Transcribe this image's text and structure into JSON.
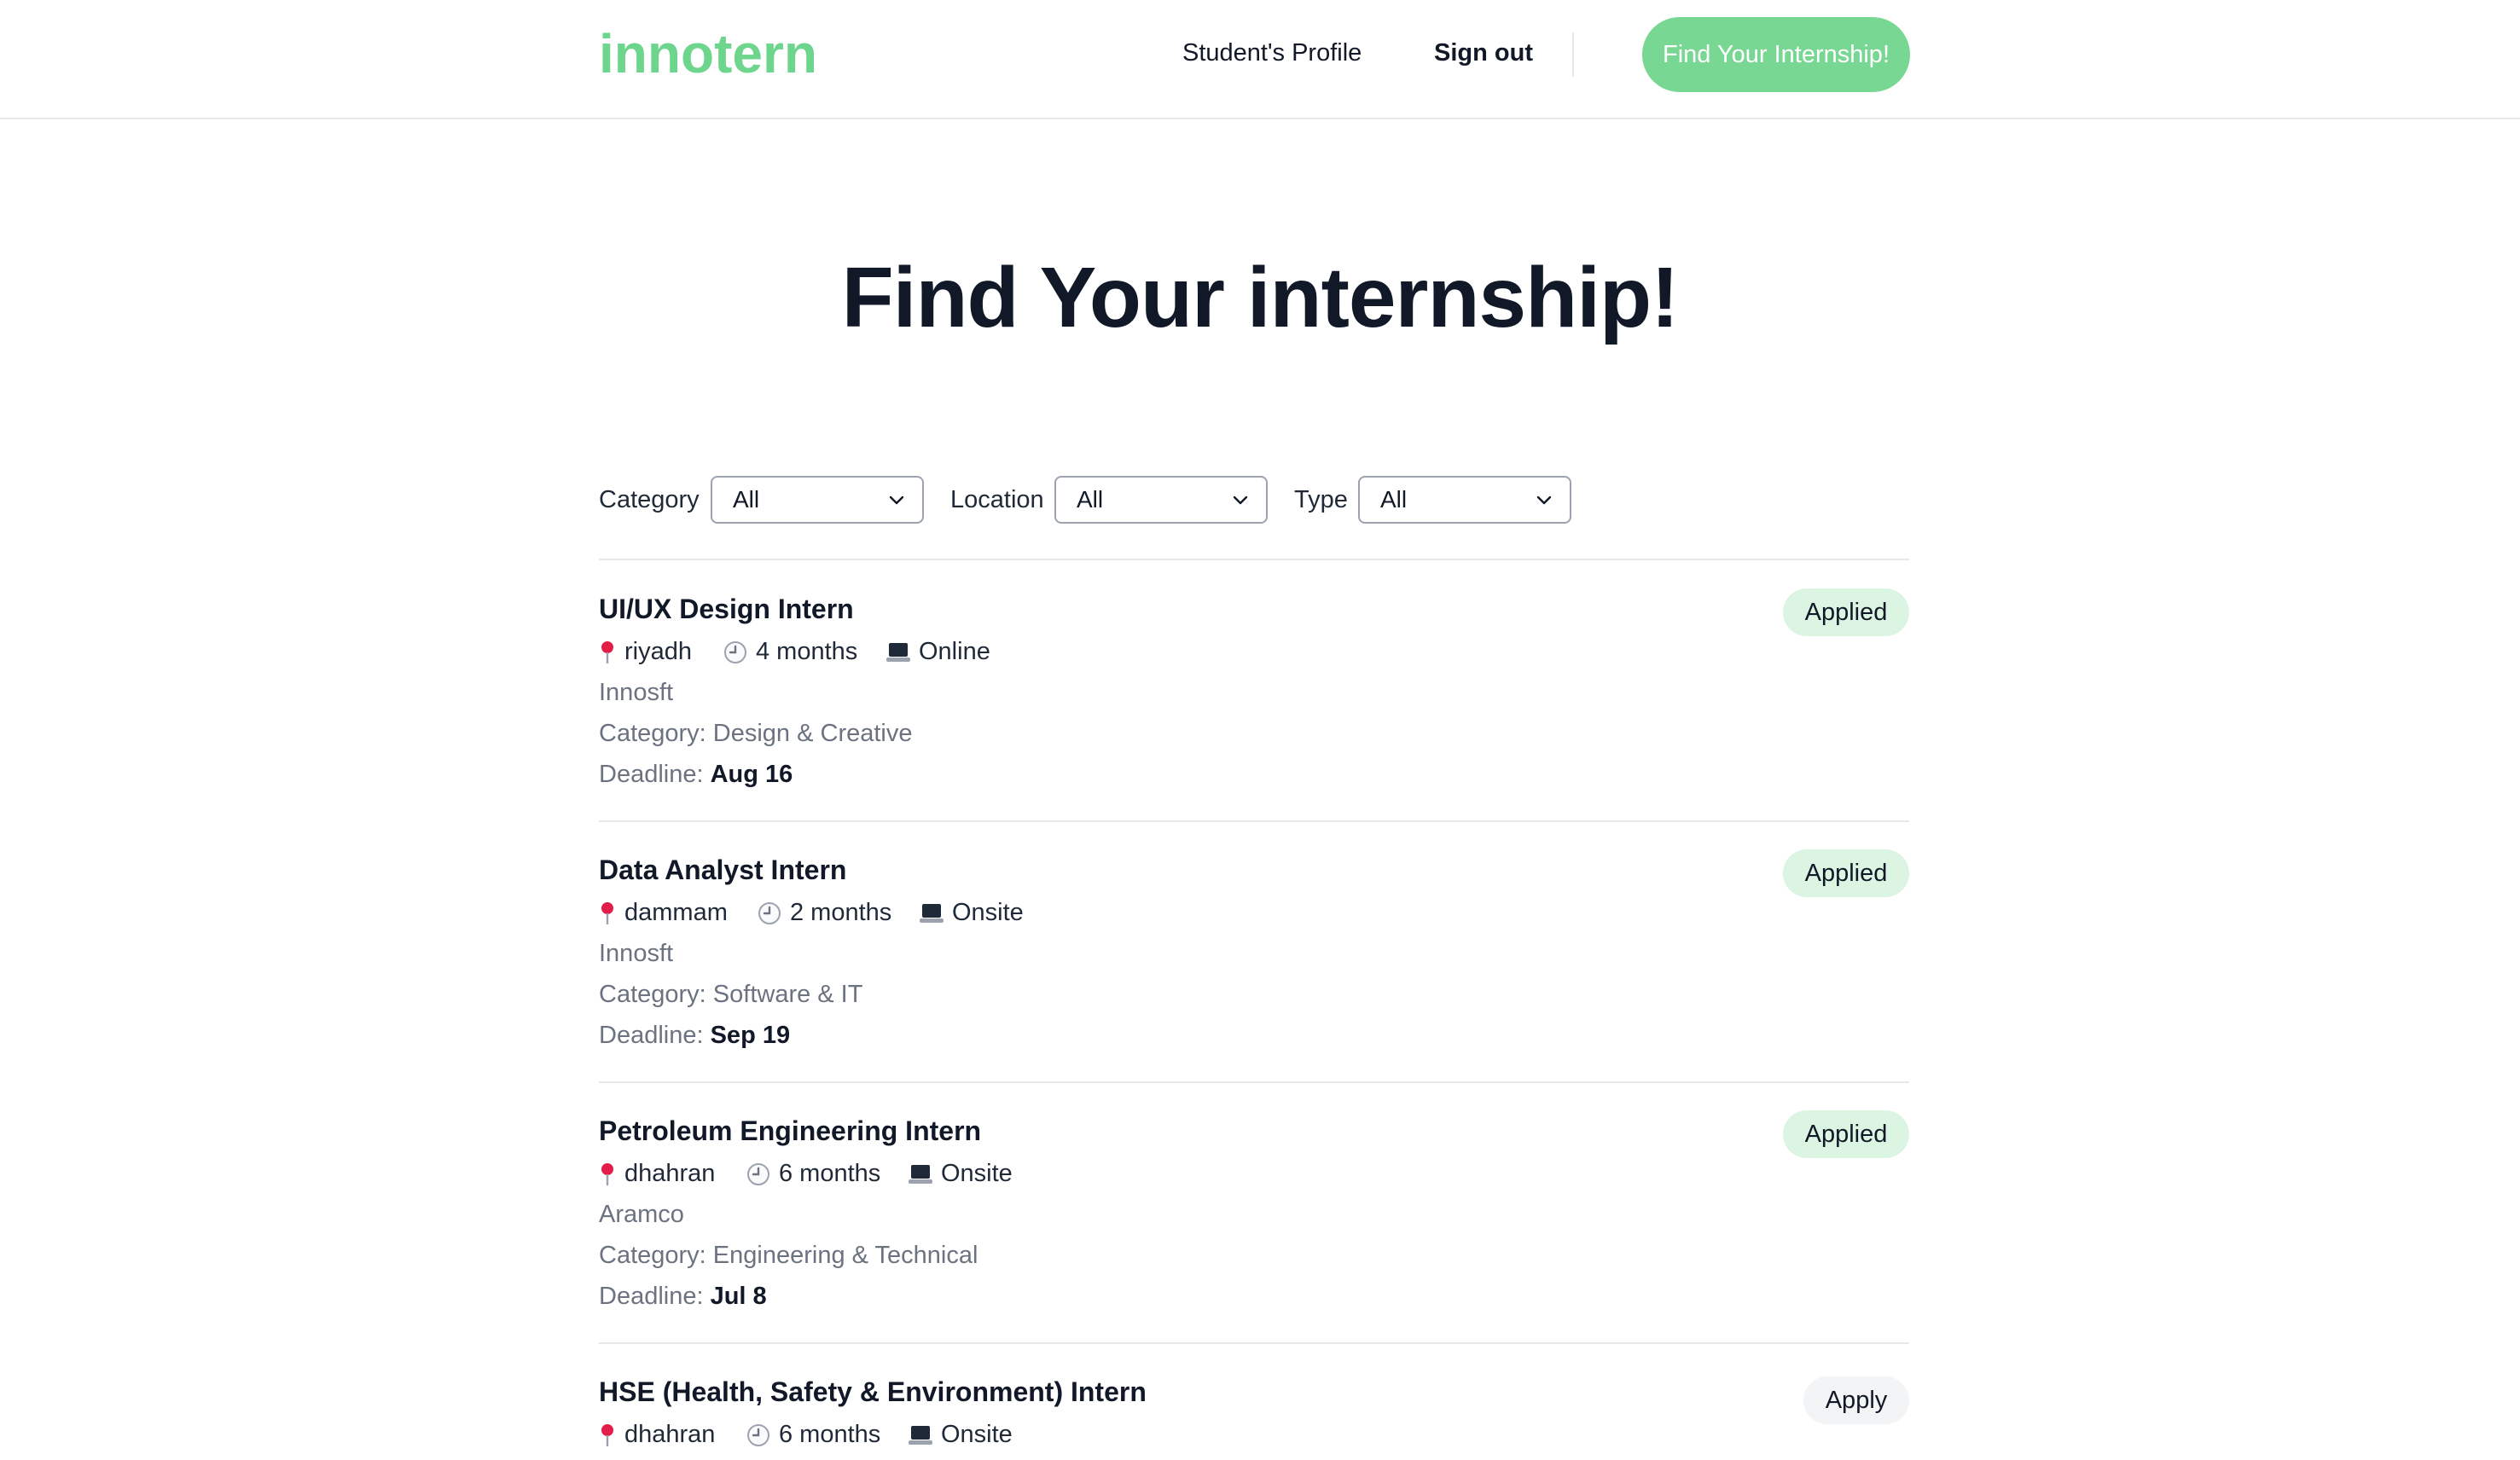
{
  "header": {
    "logo": "innotern",
    "nav_profile": "Student's Profile",
    "nav_signout": "Sign out",
    "cta": "Find Your Internship!",
    "accent_color": "#6dd58c"
  },
  "main": {
    "title": "Find Your internship!",
    "filters": [
      {
        "label": "Category",
        "value": "All"
      },
      {
        "label": "Location",
        "value": "All"
      },
      {
        "label": "Type",
        "value": "All"
      }
    ],
    "listings": [
      {
        "title": "UI/UX Design Intern",
        "location": "riyadh",
        "duration": "4 months",
        "mode": "Online",
        "company": "Innosft",
        "category": "Category: Design & Creative",
        "deadline_label": "Deadline:",
        "deadline": "Aug 16",
        "status": "Applied"
      },
      {
        "title": "Data Analyst Intern",
        "location": "dammam",
        "duration": "2 months",
        "mode": "Onsite",
        "company": "Innosft",
        "category": "Category: Software & IT",
        "deadline_label": "Deadline:",
        "deadline": "Sep 19",
        "status": "Applied"
      },
      {
        "title": "Petroleum Engineering Intern",
        "location": "dhahran",
        "duration": "6 months",
        "mode": "Onsite",
        "company": "Aramco",
        "category": "Category: Engineering & Technical",
        "deadline_label": "Deadline:",
        "deadline": "Jul 8",
        "status": "Applied"
      },
      {
        "title": "HSE (Health, Safety & Environment) Intern",
        "location": "dhahran",
        "duration": "6 months",
        "mode": "Onsite",
        "status": "Apply"
      }
    ]
  },
  "icons": {
    "location": "pin-icon",
    "duration": "clock-icon",
    "mode": "laptop-icon",
    "select": "chevron-down-icon"
  }
}
